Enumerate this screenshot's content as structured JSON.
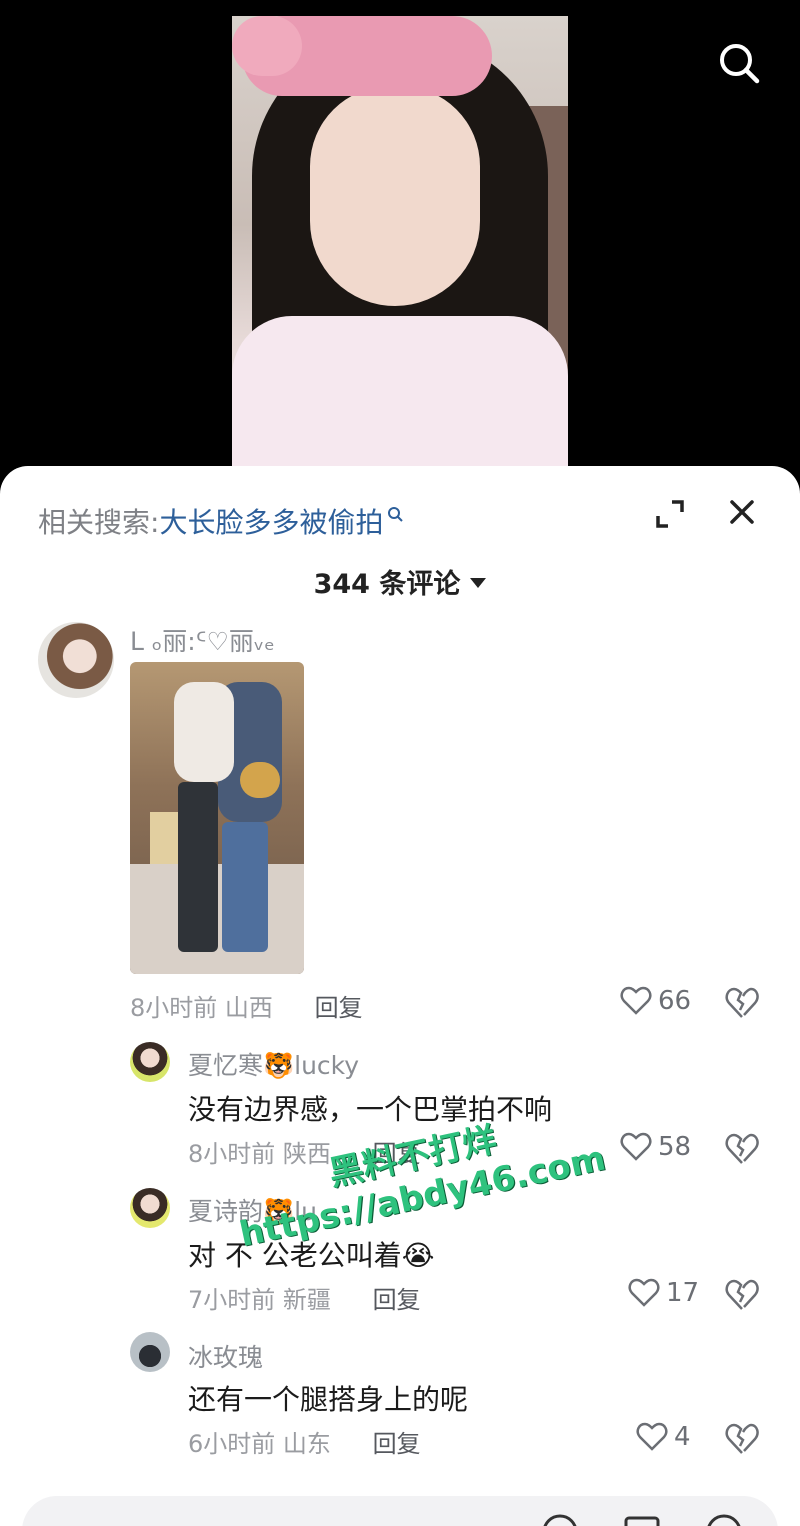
{
  "header": {
    "search_icon": "search-icon"
  },
  "sheet": {
    "related_label": "相关搜索:",
    "related_keyword": "大长脸多多被偷拍",
    "expand_icon": "expand-icon",
    "close_icon": "close-icon",
    "comment_count": "344 条评论"
  },
  "comments": [
    {
      "username": "ᒪ ₒ丽:ᑦ♡丽ᵥₑ",
      "text": "",
      "time": "8小时前",
      "location": "山西",
      "reply": "回复",
      "likes": "66"
    },
    {
      "username": "夏忆寒🐯lucky",
      "text": "没有边界感，一个巴掌拍不响",
      "time": "8小时前",
      "location": "陕西",
      "reply": "回复",
      "likes": "58"
    },
    {
      "username": "夏诗韵🐯lu",
      "text": "对 不 公老公叫着😭",
      "time": "7小时前",
      "location": "新疆",
      "reply": "回复",
      "likes": "17"
    },
    {
      "username": "冰玫瑰",
      "text": "还有一个腿搭身上的呢",
      "time": "6小时前",
      "location": "山东",
      "reply": "回复",
      "likes": "4"
    }
  ],
  "watermark": {
    "line1": "黑料不打烊",
    "line2": "https://abdy46.com"
  },
  "input": {
    "placeholder": ""
  },
  "colors": {
    "link": "#2d5f9a",
    "sheet_bg": "#ffffff",
    "watermark": "#2ec27e"
  }
}
